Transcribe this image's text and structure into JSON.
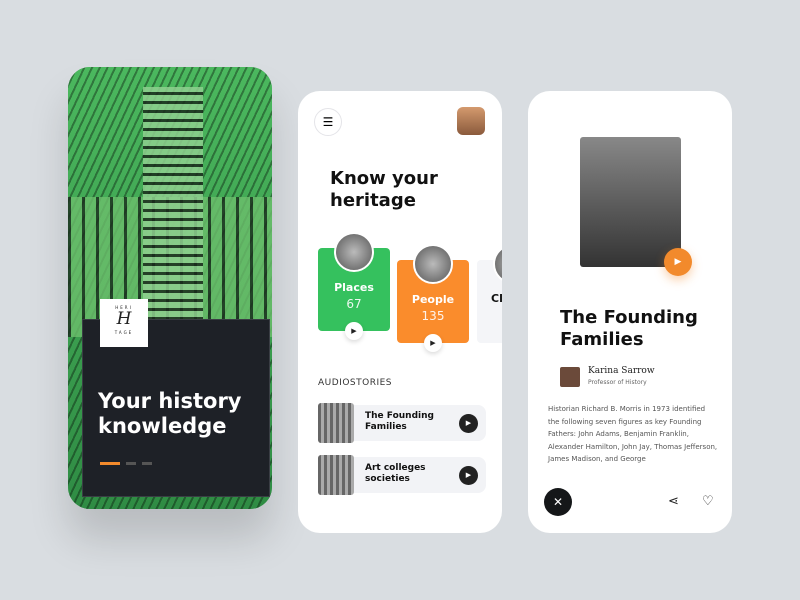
{
  "onboarding": {
    "logo": {
      "top": "HERI",
      "mark": "H",
      "bottom": "TAGE"
    },
    "headline": [
      "Your history",
      "knowledge"
    ],
    "pager": {
      "count": 3,
      "active": 0
    }
  },
  "home": {
    "menu_icon": "hamburger-icon",
    "title": [
      "Know your",
      "heritage"
    ],
    "categories": [
      {
        "label": "Places",
        "count": "67",
        "color": "#35c15e"
      },
      {
        "label": "People",
        "count": "135",
        "color": "#fa8c2c"
      },
      {
        "label": "Cl",
        "count": "",
        "color": "#f4f5f8"
      }
    ],
    "section": "AUDIOSTORIES",
    "stories": [
      {
        "title": [
          "The Founding",
          "Families"
        ]
      },
      {
        "title": [
          "Art colleges",
          "societies"
        ]
      }
    ]
  },
  "detail": {
    "title": [
      "The Founding",
      "Families"
    ],
    "author": {
      "name": "Karina Sarrow",
      "role": "Professor of History"
    },
    "body": "Historian Richard B. Morris in 1973 identified the following seven figures as key Founding Fathers: John Adams, Benjamin Franklin, Alexander Hamilton, John Jay, Thomas Jefferson, James Madison, and George",
    "accent": "#f28a2c"
  }
}
